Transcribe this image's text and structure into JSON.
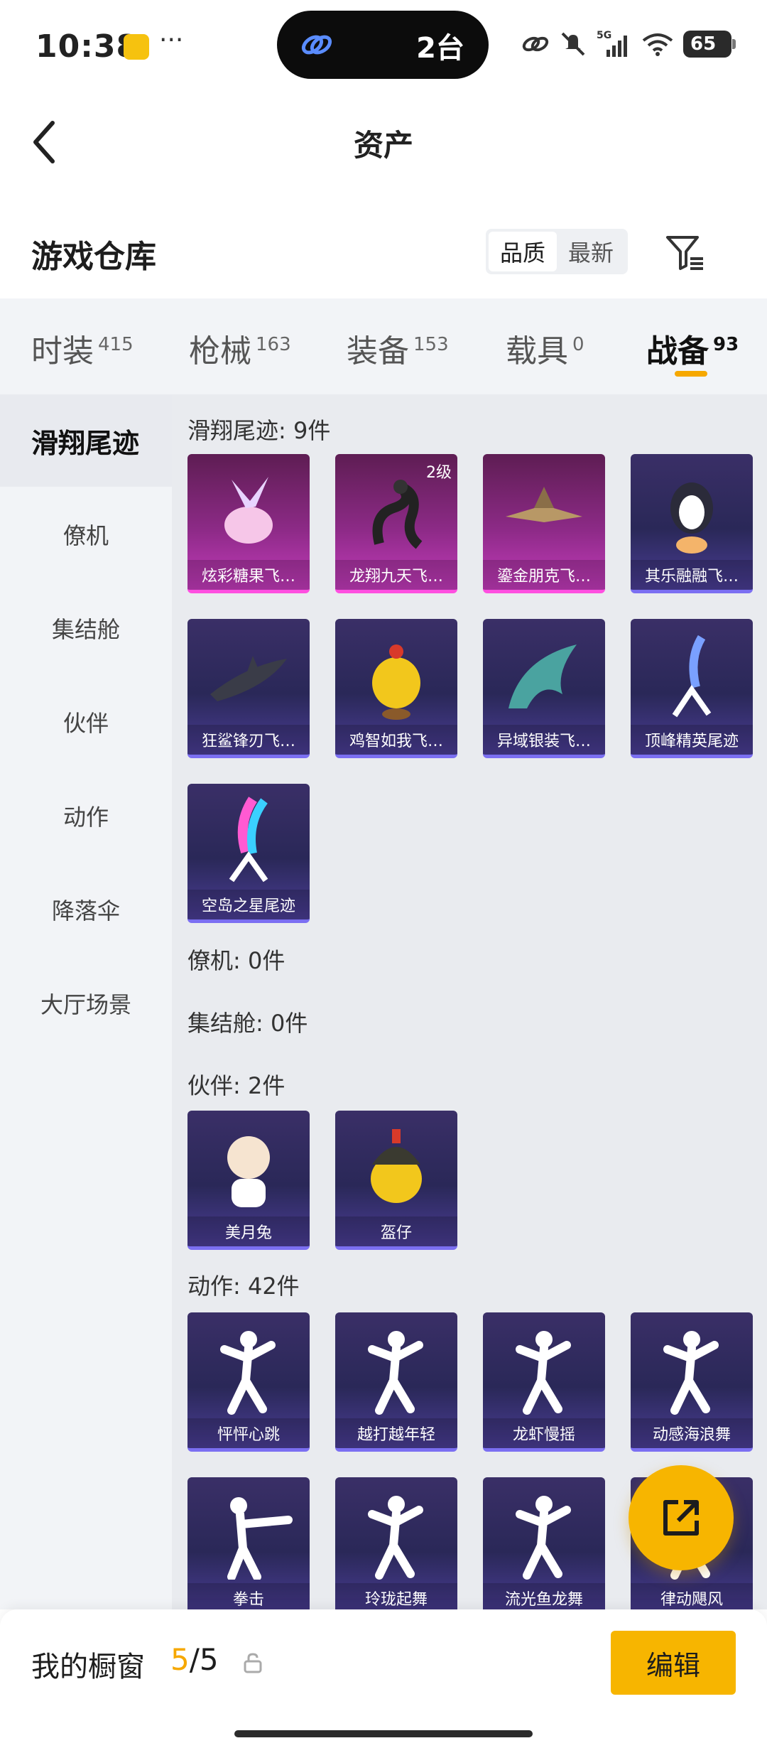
{
  "status_bar": {
    "time": "10:38",
    "dots": "···",
    "island_text": "2台",
    "battery": "65"
  },
  "header": {
    "title": "资产"
  },
  "section": {
    "title": "游戏仓库",
    "sort_quality": "品质",
    "sort_latest": "最新"
  },
  "tabs": [
    {
      "label": "时装",
      "count": "415"
    },
    {
      "label": "枪械",
      "count": "163"
    },
    {
      "label": "装备",
      "count": "153"
    },
    {
      "label": "载具",
      "count": "0"
    },
    {
      "label": "战备",
      "count": "93"
    }
  ],
  "categories": [
    "滑翔尾迹",
    "僚机",
    "集结舱",
    "伙伴",
    "动作",
    "降落伞",
    "大厅场景"
  ],
  "groups": {
    "glide": {
      "label": "滑翔尾迹: 9件",
      "items": [
        {
          "name": "炫彩糖果飞…",
          "rarity": "pink",
          "icon": "candy-icon"
        },
        {
          "name": "龙翔九天飞…",
          "rarity": "pink",
          "badge": "2级",
          "icon": "dragon-icon"
        },
        {
          "name": "鎏金朋克飞…",
          "rarity": "pink",
          "icon": "jet-icon"
        },
        {
          "name": "其乐融融飞…",
          "rarity": "purple",
          "icon": "penguin-icon"
        },
        {
          "name": "狂鲨锋刃飞…",
          "rarity": "purple",
          "icon": "shark-icon"
        },
        {
          "name": "鸡智如我飞…",
          "rarity": "purple",
          "icon": "chicken-icon"
        },
        {
          "name": "异域银装飞…",
          "rarity": "purple",
          "icon": "wing-icon"
        },
        {
          "name": "顶峰精英尾迹",
          "rarity": "purple",
          "icon": "trail-icon"
        },
        {
          "name": "空岛之星尾迹",
          "rarity": "purple",
          "icon": "rainbow-trail-icon"
        }
      ]
    },
    "wingman": {
      "label": "僚机: 0件"
    },
    "capsule": {
      "label": "集结舱: 0件"
    },
    "partner": {
      "label": "伙伴: 2件",
      "items": [
        {
          "name": "美月兔",
          "rarity": "purple",
          "icon": "rabbit-icon"
        },
        {
          "name": "盔仔",
          "rarity": "purple",
          "icon": "helmet-chick-icon"
        }
      ]
    },
    "emote": {
      "label": "动作: 42件",
      "items": [
        {
          "name": "怦怦心跳",
          "rarity": "purple",
          "icon": "dance-icon"
        },
        {
          "name": "越打越年轻",
          "rarity": "purple",
          "icon": "dance-icon"
        },
        {
          "name": "龙虾慢摇",
          "rarity": "purple",
          "icon": "dance-icon"
        },
        {
          "name": "动感海浪舞",
          "rarity": "purple",
          "icon": "dance-icon"
        },
        {
          "name": "拳击",
          "rarity": "purple",
          "icon": "punch-icon"
        },
        {
          "name": "玲珑起舞",
          "rarity": "purple",
          "icon": "dance-icon"
        },
        {
          "name": "流光鱼龙舞",
          "rarity": "purple",
          "icon": "dance-icon"
        },
        {
          "name": "律动飓风",
          "rarity": "purple",
          "icon": "dance-icon"
        }
      ]
    }
  },
  "bottom": {
    "window_label": "我的橱窗",
    "count_current": "5",
    "count_total": "/5",
    "edit_label": "编辑"
  },
  "colors": {
    "accent": "#f7b500",
    "pink_rarity": "#ff4fe0",
    "purple_rarity": "#7b6ff2"
  }
}
